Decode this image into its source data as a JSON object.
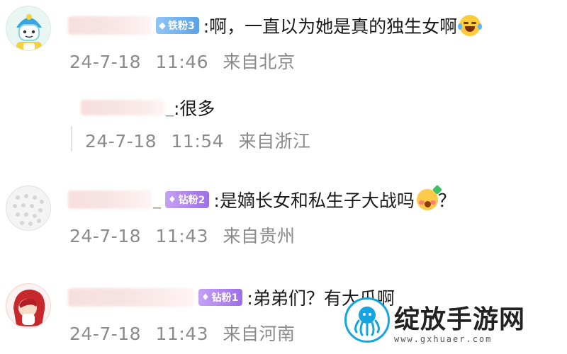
{
  "comments": [
    {
      "badge": {
        "label": "铁粉3",
        "level_type": "iron",
        "icon": "diamond-icon",
        "color": "#6aaeea"
      },
      "text": ":啊，一直以为她是真的独生女啊",
      "emoji": "laughing-tears-emoji",
      "date": "24-7-18",
      "time": "11:46",
      "location": "来自北京"
    },
    {
      "name_suffix": "_",
      "text": ":很多",
      "date": "24-7-18",
      "time": "11:54",
      "location": "来自浙江",
      "is_reply": true
    },
    {
      "name_suffix": "_",
      "badge": {
        "label": "钻粉2",
        "level_type": "drill",
        "icon": "gem-icon",
        "color": "#a97cec"
      },
      "text": ":是嫡长女和私生子大战吗",
      "emoji": "blushing-emoji",
      "text_after": "？",
      "date": "24-7-18",
      "time": "11:43",
      "location": "来自贵州"
    },
    {
      "badge": {
        "label": "钻粉1",
        "level_type": "drill",
        "icon": "gem-icon",
        "color": "#a97cec"
      },
      "text": ":弟弟们？有大瓜啊",
      "date": "24-7-18",
      "time": "11:43",
      "location": "来自河南"
    }
  ],
  "watermark": {
    "title": "绽放手游网",
    "url": "www.gxhuaer.com",
    "icon": "octopus-logo-icon",
    "color": "#14a4e0"
  }
}
